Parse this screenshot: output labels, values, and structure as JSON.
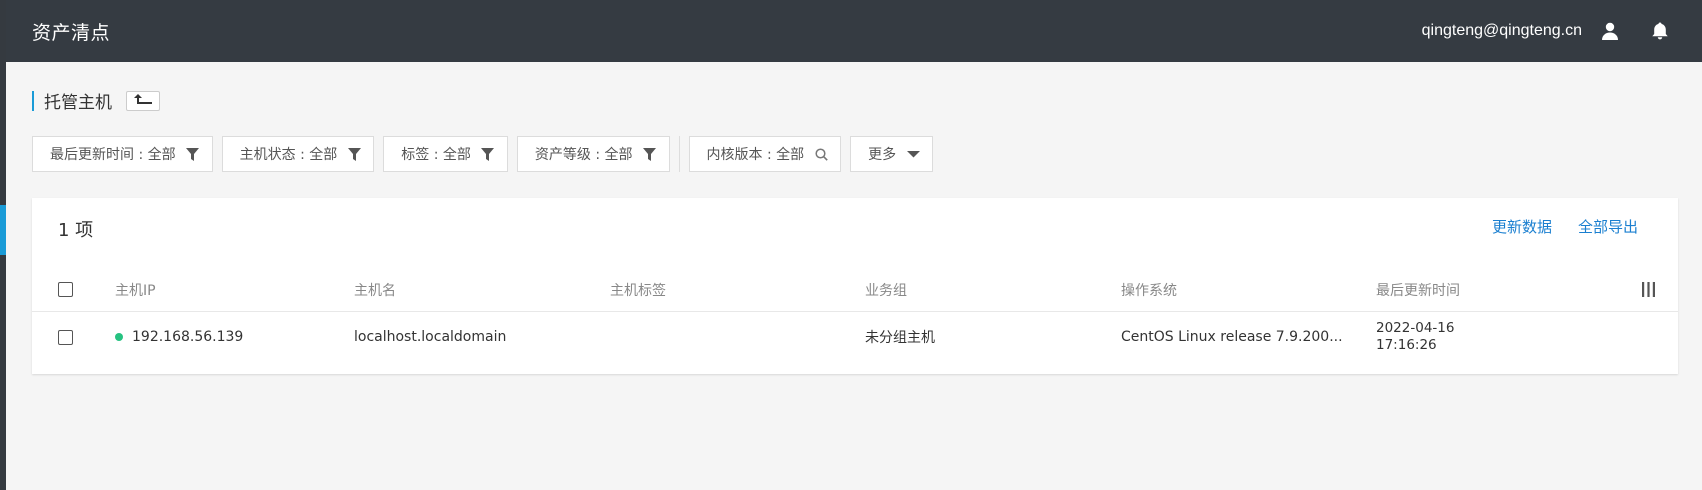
{
  "app": {
    "title": "资产清点"
  },
  "user": {
    "email": "qingteng@qingteng.cn"
  },
  "page": {
    "title": "托管主机"
  },
  "filters": [
    {
      "label": "最后更新时间 : 全部",
      "icon": "filter-icon"
    },
    {
      "label": "主机状态 : 全部",
      "icon": "filter-icon"
    },
    {
      "label": "标签 : 全部",
      "icon": "filter-icon"
    },
    {
      "label": "资产等级 : 全部",
      "icon": "filter-icon"
    },
    {
      "label": "内核版本 : 全部",
      "icon": "search-icon"
    },
    {
      "label": "更多",
      "icon": "caret-down-icon"
    }
  ],
  "table": {
    "count": "1 项",
    "actions": {
      "refresh": "更新数据",
      "export": "全部导出"
    },
    "columns": [
      "主机IP",
      "主机名",
      "主机标签",
      "业务组",
      "操作系统",
      "最后更新时间"
    ],
    "rows": [
      {
        "ip": "192.168.56.139",
        "hostname": "localhost.localdomain",
        "tags": "",
        "group": "未分组主机",
        "os": "CentOS Linux release 7.9.200...",
        "updated_date": "2022-04-16",
        "updated_time": "17:16:26",
        "status_color": "#26c281"
      }
    ]
  },
  "colors": {
    "topbar": "#353b42",
    "accent": "#1a9bd7",
    "link": "#1a7fd0"
  }
}
